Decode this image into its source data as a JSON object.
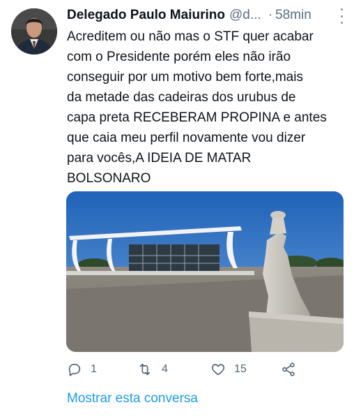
{
  "tweet": {
    "author_name": "Delegado Paulo Maiurino",
    "handle": "@d...",
    "separator": "·",
    "time": "58min",
    "text_lines": [
      "Acreditem ou não mas o STF quer acabar",
      "com o Presidente porém eles não irão",
      "conseguir por um motivo bem forte,mais",
      "da metade das cadeiras dos urubus de",
      "capa preta RECEBERAM PROPINA e antes",
      "que caia meu perfil novamente vou dizer",
      "para vocês,A IDEIA DE MATAR",
      "BOLSONARO"
    ]
  },
  "actions": {
    "replies": "1",
    "retweets": "4",
    "likes": "15"
  },
  "show_thread_label": "Mostrar esta conversa",
  "icons": {
    "more": "more-vertical-icon",
    "reply": "reply-icon",
    "retweet": "retweet-icon",
    "like": "heart-icon",
    "share": "share-icon"
  },
  "colors": {
    "link": "#1d9bf0",
    "secondary_text": "#5b7083",
    "icon": "#536471"
  }
}
